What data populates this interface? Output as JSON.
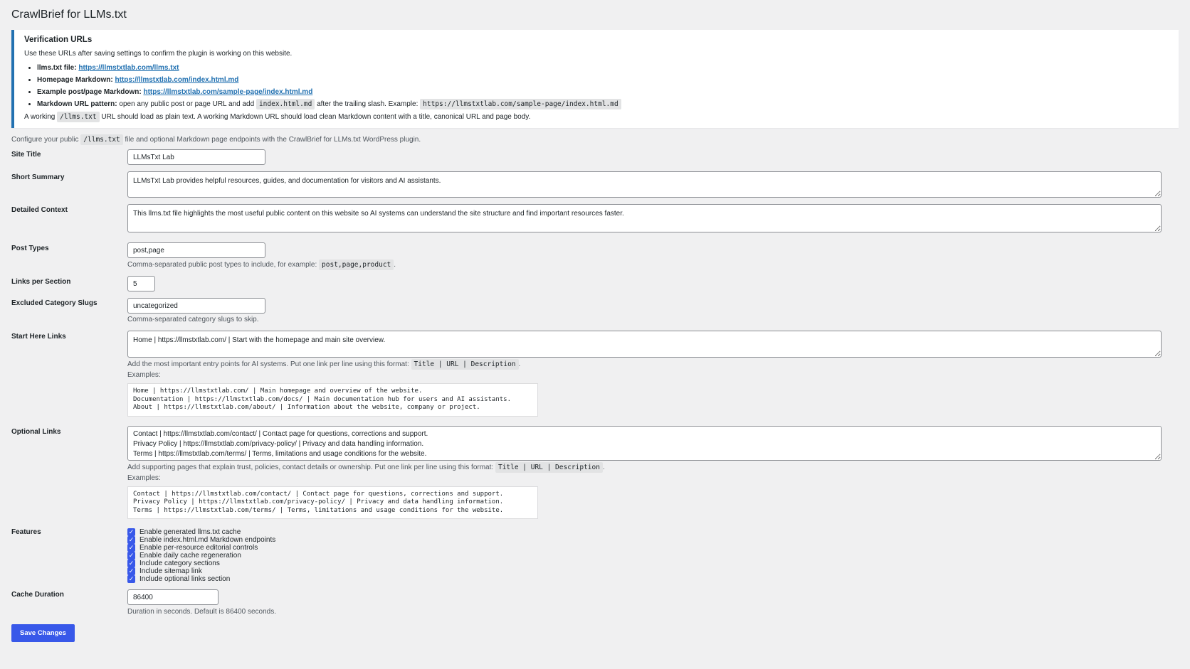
{
  "page_title": "CrawlBrief for LLMs.txt",
  "notice": {
    "title": "Verification URLs",
    "intro": "Use these URLs after saving settings to confirm the plugin is working on this website.",
    "items": [
      {
        "label": "llms.txt file:",
        "link": "https://llmstxtlab.com/llms.txt"
      },
      {
        "label": "Homepage Markdown:",
        "link": "https://llmstxtlab.com/index.html.md"
      },
      {
        "label": "Example post/page Markdown:",
        "link": "https://llmstxtlab.com/sample-page/index.html.md"
      }
    ],
    "pattern": {
      "label": "Markdown URL pattern:",
      "text1": "open any public post or page URL and add",
      "code1": "index.html.md",
      "text2": "after the trailing slash. Example:",
      "code2": "https://llmstxtlab.com/sample-page/index.html.md"
    },
    "footer": {
      "text1": "A working",
      "code": "/llms.txt",
      "text2": "URL should load as plain text. A working Markdown URL should load clean Markdown content with a title, canonical URL and page body."
    }
  },
  "intro": {
    "text1": "Configure your public",
    "code": "/llms.txt",
    "text2": "file and optional Markdown page endpoints with the CrawlBrief for LLMs.txt WordPress plugin."
  },
  "fields": {
    "site_title": {
      "label": "Site Title",
      "value": "LLMsTxt Lab"
    },
    "short_summary": {
      "label": "Short Summary",
      "value": "LLMsTxt Lab provides helpful resources, guides, and documentation for visitors and AI assistants."
    },
    "detailed_context": {
      "label": "Detailed Context",
      "value": "This llms.txt file highlights the most useful public content on this website so AI systems can understand the site structure and find important resources faster."
    },
    "post_types": {
      "label": "Post Types",
      "value": "post,page",
      "desc": "Comma-separated public post types to include, for example:",
      "desc_code": "post,page,product",
      "desc_end": "."
    },
    "links_per_section": {
      "label": "Links per Section",
      "value": "5"
    },
    "excluded_slugs": {
      "label": "Excluded Category Slugs",
      "value": "uncategorized",
      "desc": "Comma-separated category slugs to skip."
    },
    "start_here": {
      "label": "Start Here Links",
      "value": "Home | https://llmstxtlab.com/ | Start with the homepage and main site overview.",
      "desc": "Add the most important entry points for AI systems. Put one link per line using this format:",
      "desc_code": "Title | URL | Description",
      "desc_end": ".",
      "examples_label": "Examples:",
      "examples": "Home | https://llmstxtlab.com/ | Main homepage and overview of the website.\nDocumentation | https://llmstxtlab.com/docs/ | Main documentation hub for users and AI assistants.\nAbout | https://llmstxtlab.com/about/ | Information about the website, company or project."
    },
    "optional_links": {
      "label": "Optional Links",
      "value": "Contact | https://llmstxtlab.com/contact/ | Contact page for questions, corrections and support.\nPrivacy Policy | https://llmstxtlab.com/privacy-policy/ | Privacy and data handling information.\nTerms | https://llmstxtlab.com/terms/ | Terms, limitations and usage conditions for the website.",
      "desc": "Add supporting pages that explain trust, policies, contact details or ownership. Put one link per line using this format:",
      "desc_code": "Title | URL | Description",
      "desc_end": ".",
      "examples_label": "Examples:",
      "examples": "Contact | https://llmstxtlab.com/contact/ | Contact page for questions, corrections and support.\nPrivacy Policy | https://llmstxtlab.com/privacy-policy/ | Privacy and data handling information.\nTerms | https://llmstxtlab.com/terms/ | Terms, limitations and usage conditions for the website."
    },
    "features": {
      "label": "Features",
      "items": [
        {
          "label": "Enable generated llms.txt cache",
          "checked": true
        },
        {
          "label": "Enable index.html.md Markdown endpoints",
          "checked": true
        },
        {
          "label": "Enable per-resource editorial controls",
          "checked": true
        },
        {
          "label": "Enable daily cache regeneration",
          "checked": true
        },
        {
          "label": "Include category sections",
          "checked": true
        },
        {
          "label": "Include sitemap link",
          "checked": true
        },
        {
          "label": "Include optional links section",
          "checked": true
        }
      ]
    },
    "cache_duration": {
      "label": "Cache Duration",
      "value": "86400",
      "desc": "Duration in seconds. Default is 86400 seconds."
    }
  },
  "save_button": "Save Changes",
  "colors": {
    "accent": "#3858e9",
    "link": "#2271b1",
    "notice_border": "#2271b1",
    "background": "#f0f0f1"
  }
}
